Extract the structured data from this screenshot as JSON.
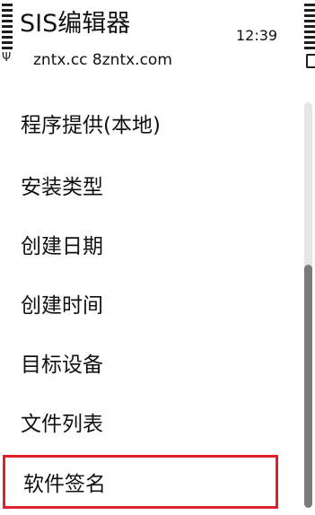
{
  "header": {
    "title": "SIS编辑器",
    "subtitle": "zntx.cc  8zntx.com",
    "time": "12:39"
  },
  "menu": {
    "items": [
      {
        "label": "程序提供(本地)"
      },
      {
        "label": "安装类型"
      },
      {
        "label": "创建日期"
      },
      {
        "label": "创建时间"
      },
      {
        "label": "目标设备"
      },
      {
        "label": "文件列表"
      },
      {
        "label": "软件签名"
      }
    ]
  },
  "scroll": {
    "thumb_fraction": 0.6
  },
  "colors": {
    "highlight_border": "#e0202a",
    "text": "#111111",
    "scroll_thumb": "#7a7a7a"
  }
}
